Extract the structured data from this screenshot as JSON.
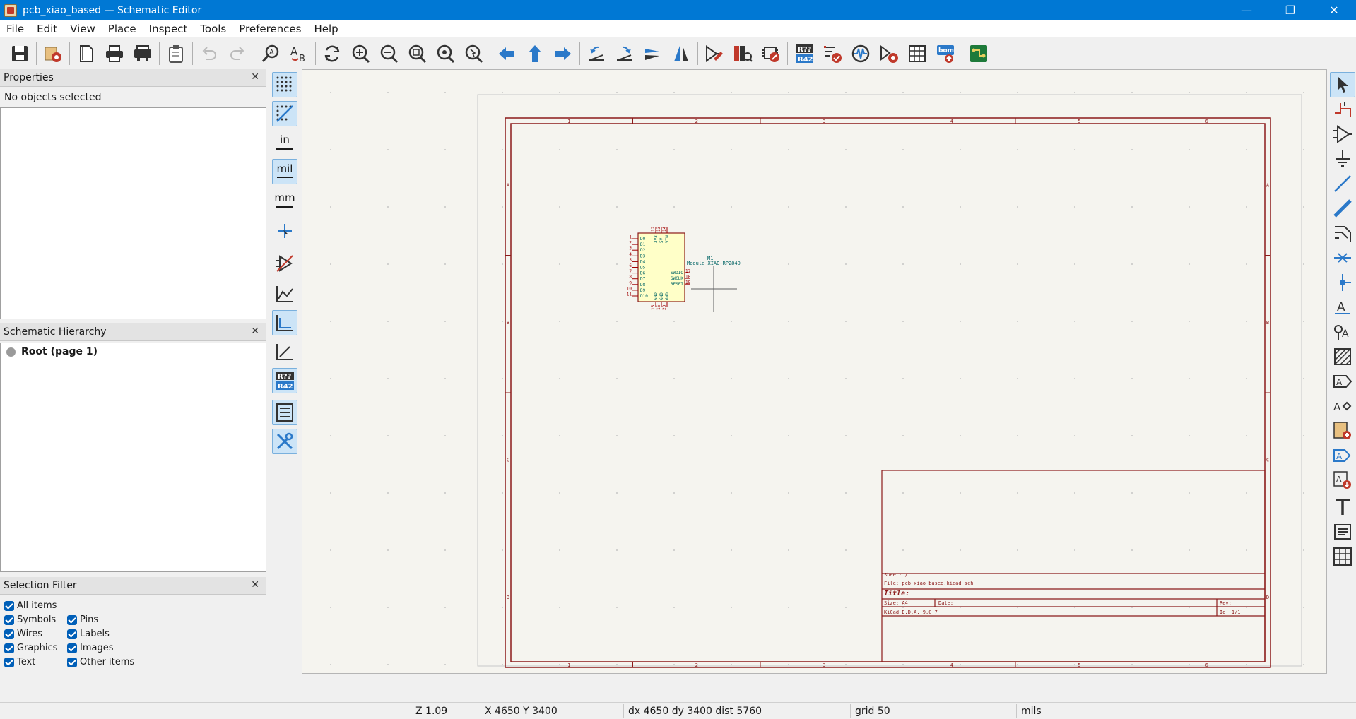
{
  "window": {
    "title": "pcb_xiao_based — Schematic Editor",
    "minimize": "—",
    "maximize": "❐",
    "close": "✕"
  },
  "menu": [
    "File",
    "Edit",
    "View",
    "Place",
    "Inspect",
    "Tools",
    "Preferences",
    "Help"
  ],
  "panels": {
    "properties": {
      "title": "Properties",
      "status": "No objects selected"
    },
    "hierarchy": {
      "title": "Schematic Hierarchy",
      "root": "Root (page 1)"
    },
    "filter": {
      "title": "Selection Filter",
      "left": [
        "All items",
        "Symbols",
        "Wires",
        "Graphics",
        "Text"
      ],
      "right": [
        "Pins",
        "Labels",
        "Images",
        "Other items"
      ]
    }
  },
  "units": {
    "in": "in",
    "mil": "mil",
    "mm": "mm"
  },
  "annotate_icon": {
    "top": "R??",
    "bottom": "R42"
  },
  "sheet": {
    "columns": [
      "1",
      "2",
      "3",
      "4",
      "5",
      "6"
    ],
    "rows": [
      "A",
      "B",
      "C",
      "D"
    ],
    "title_block": {
      "sheet": "Sheet: /",
      "file": "File: pcb_xiao_based.kicad_sch",
      "title": "Title:",
      "size": "Size: A4",
      "date": "Date:",
      "rev": "Rev:",
      "kicad": "KiCad E.D.A.  9.0.7",
      "id": "Id: 1/1"
    }
  },
  "symbol": {
    "ref": "M1",
    "value": "Module_XIAO-RP2040",
    "left_pins": [
      "D0",
      "D1",
      "D2",
      "D3",
      "D4",
      "D5",
      "D6",
      "D7",
      "D8",
      "D9",
      "D10"
    ],
    "left_numbers": [
      "1",
      "2",
      "3",
      "4",
      "5",
      "6",
      "7",
      "8",
      "9",
      "10",
      "11"
    ],
    "top_pins": [
      "3V3",
      "5V",
      "VIN"
    ],
    "top_numbers": [
      "12",
      "13",
      "14"
    ],
    "right_pins": [
      "SWDIO",
      "SWCLK",
      "RESET"
    ],
    "right_numbers": [
      "17",
      "18",
      "19"
    ],
    "bottom_pins": [
      "GND",
      "GND",
      "GND"
    ],
    "bottom_numbers": [
      "15",
      "16",
      "20"
    ]
  },
  "status": {
    "zoom": "Z 1.09",
    "xy": "X 4650  Y 3400",
    "delta": "dx 4650  dy 3400  dist 5760",
    "grid": "grid 50",
    "units": "mils"
  },
  "colors": {
    "titlebar": "#0078d4",
    "accent": "#2b79c9",
    "sheet_border": "#8b1a1a",
    "symbol_fill": "#ffffc8",
    "symbol_text": "#006464",
    "pin_number": "#a00000"
  }
}
